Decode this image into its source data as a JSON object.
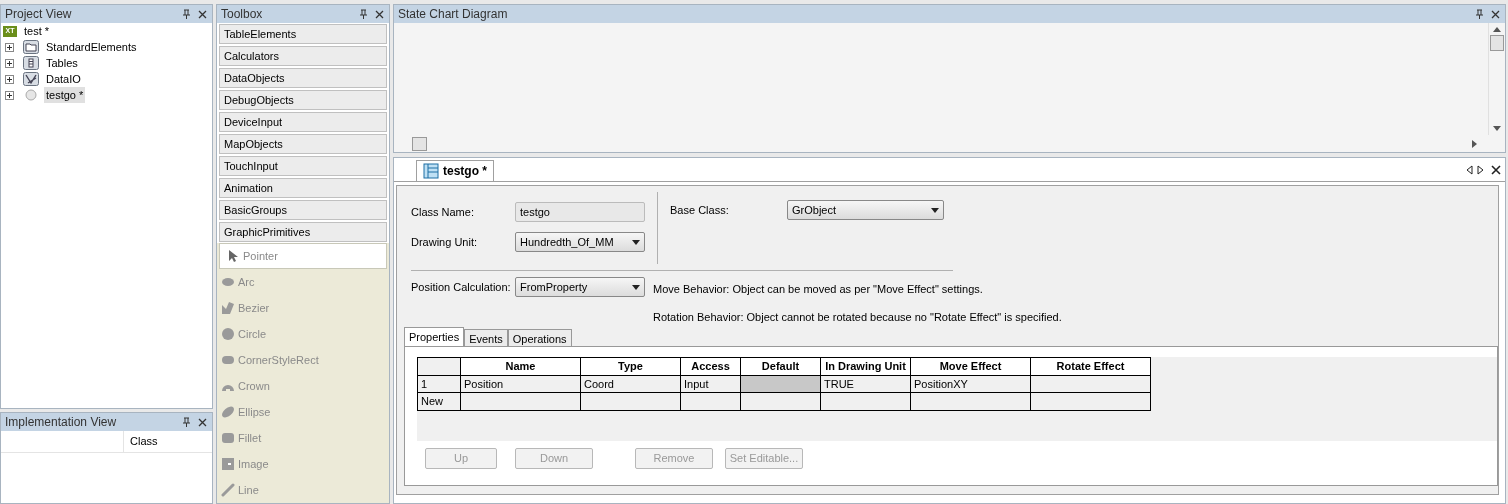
{
  "project_view": {
    "title": "Project View",
    "tree": [
      {
        "label": "test *",
        "kind": "xt",
        "icon_text": "XT",
        "selected": false,
        "children": [
          {
            "label": "StandardElements",
            "kind": "folder",
            "selected": false,
            "expanded": false
          },
          {
            "label": "Tables",
            "kind": "table",
            "selected": false,
            "expanded": false
          },
          {
            "label": "DataIO",
            "kind": "dataio",
            "selected": false,
            "expanded": false
          },
          {
            "label": "testgo *",
            "kind": "ball",
            "selected": true,
            "expanded": false
          }
        ]
      }
    ]
  },
  "implementation_view": {
    "title": "Implementation View",
    "columns": [
      "Class"
    ]
  },
  "toolbox": {
    "title": "Toolbox",
    "groups": [
      "TableElements",
      "Calculators",
      "DataObjects",
      "DebugObjects",
      "DeviceInput",
      "MapObjects",
      "TouchInput",
      "Animation",
      "BasicGroups",
      "GraphicPrimitives"
    ],
    "tools": [
      {
        "label": "Pointer",
        "kind": "pointer",
        "selected": true
      },
      {
        "label": "Arc",
        "kind": "arc",
        "selected": false
      },
      {
        "label": "Bezier",
        "kind": "bezier",
        "selected": false
      },
      {
        "label": "Circle",
        "kind": "circle",
        "selected": false
      },
      {
        "label": "CornerStyleRect",
        "kind": "rect",
        "selected": false
      },
      {
        "label": "Crown",
        "kind": "crown",
        "selected": false
      },
      {
        "label": "Ellipse",
        "kind": "ellipse",
        "selected": false
      },
      {
        "label": "Fillet",
        "kind": "fillet",
        "selected": false
      },
      {
        "label": "Image",
        "kind": "image",
        "selected": false
      },
      {
        "label": "Line",
        "kind": "line",
        "selected": false
      }
    ]
  },
  "state_chart": {
    "title": "State Chart Diagram"
  },
  "editor": {
    "tab": {
      "label": "testgo *",
      "selected": true
    },
    "class_name": {
      "label": "Class Name:",
      "value": "testgo"
    },
    "drawing_unit": {
      "label": "Drawing Unit:",
      "value": "Hundredth_Of_MM"
    },
    "base_class": {
      "label": "Base Class:",
      "value": "GrObject"
    },
    "position_calculation": {
      "label": "Position Calculation:",
      "value": "FromProperty"
    },
    "move_behavior": "Move Behavior: Object can be moved as per \"Move Effect\" settings.",
    "rotation_behavior": "Rotation Behavior: Object cannot be rotated because no \"Rotate Effect\" is specified.",
    "tabs": [
      {
        "label": "Properties",
        "selected": true
      },
      {
        "label": "Events",
        "selected": false
      },
      {
        "label": "Operations",
        "selected": false
      }
    ],
    "table": {
      "columns": [
        "Name",
        "Type",
        "Access",
        "Default",
        "In Drawing Unit",
        "Move Effect",
        "Rotate Effect"
      ],
      "rows": [
        {
          "header": "1",
          "cells": [
            "Position",
            "Coord",
            "Input",
            "",
            "TRUE",
            "PositionXY",
            ""
          ],
          "default_disabled": true
        },
        {
          "header": "New",
          "cells": [
            "",
            "",
            "",
            "",
            "",
            "",
            ""
          ],
          "default_disabled": false
        }
      ]
    },
    "buttons": [
      {
        "label": "Up",
        "disabled": true
      },
      {
        "label": "Down",
        "disabled": true
      },
      {
        "label": "Remove",
        "disabled": true
      },
      {
        "label": "Set Editable...",
        "disabled": true
      }
    ]
  }
}
